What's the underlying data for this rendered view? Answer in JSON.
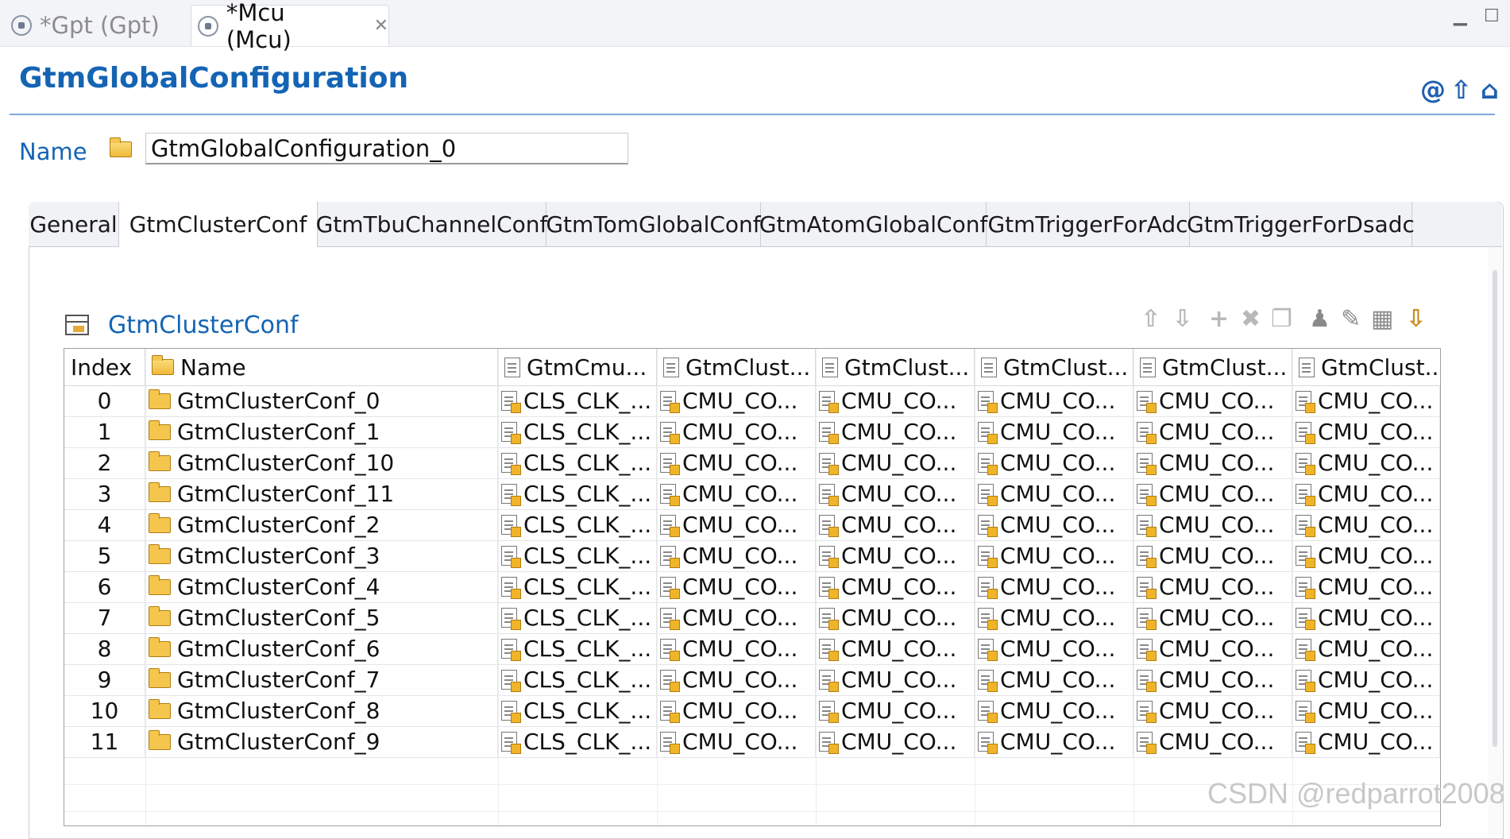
{
  "editor_tabs": [
    {
      "label": "*Gpt (Gpt)"
    },
    {
      "label": "*Mcu (Mcu)"
    }
  ],
  "title": "GtmGlobalConfiguration",
  "name_label": "Name",
  "name_value": "GtmGlobalConfiguration_0",
  "tabs": [
    "General",
    "GtmClusterConf",
    "GtmTbuChannelConf",
    "GtmTomGlobalConf",
    "GtmAtomGlobalConf",
    "GtmTriggerForAdc",
    "GtmTriggerForDsadc"
  ],
  "section_title": "GtmClusterConf",
  "table": {
    "headers": [
      "Index",
      "Name",
      "GtmCmu...",
      "GtmClust...",
      "GtmClust...",
      "GtmClust...",
      "GtmClust...",
      "GtmClust.."
    ],
    "rows": [
      {
        "index": "0",
        "name": "GtmClusterConf_0",
        "v1": "CLS_CLK_...",
        "v2": "CMU_CO...",
        "v3": "CMU_CO...",
        "v4": "CMU_CO...",
        "v5": "CMU_CO...",
        "v6": "CMU_CO..."
      },
      {
        "index": "1",
        "name": "GtmClusterConf_1",
        "v1": "CLS_CLK_...",
        "v2": "CMU_CO...",
        "v3": "CMU_CO...",
        "v4": "CMU_CO...",
        "v5": "CMU_CO...",
        "v6": "CMU_CO..."
      },
      {
        "index": "2",
        "name": "GtmClusterConf_10",
        "v1": "CLS_CLK_...",
        "v2": "CMU_CO...",
        "v3": "CMU_CO...",
        "v4": "CMU_CO...",
        "v5": "CMU_CO...",
        "v6": "CMU_CO..."
      },
      {
        "index": "3",
        "name": "GtmClusterConf_11",
        "v1": "CLS_CLK_...",
        "v2": "CMU_CO...",
        "v3": "CMU_CO...",
        "v4": "CMU_CO...",
        "v5": "CMU_CO...",
        "v6": "CMU_CO..."
      },
      {
        "index": "4",
        "name": "GtmClusterConf_2",
        "v1": "CLS_CLK_...",
        "v2": "CMU_CO...",
        "v3": "CMU_CO...",
        "v4": "CMU_CO...",
        "v5": "CMU_CO...",
        "v6": "CMU_CO..."
      },
      {
        "index": "5",
        "name": "GtmClusterConf_3",
        "v1": "CLS_CLK_...",
        "v2": "CMU_CO...",
        "v3": "CMU_CO...",
        "v4": "CMU_CO...",
        "v5": "CMU_CO...",
        "v6": "CMU_CO..."
      },
      {
        "index": "6",
        "name": "GtmClusterConf_4",
        "v1": "CLS_CLK_...",
        "v2": "CMU_CO...",
        "v3": "CMU_CO...",
        "v4": "CMU_CO...",
        "v5": "CMU_CO...",
        "v6": "CMU_CO..."
      },
      {
        "index": "7",
        "name": "GtmClusterConf_5",
        "v1": "CLS_CLK_...",
        "v2": "CMU_CO...",
        "v3": "CMU_CO...",
        "v4": "CMU_CO...",
        "v5": "CMU_CO...",
        "v6": "CMU_CO..."
      },
      {
        "index": "8",
        "name": "GtmClusterConf_6",
        "v1": "CLS_CLK_...",
        "v2": "CMU_CO...",
        "v3": "CMU_CO...",
        "v4": "CMU_CO...",
        "v5": "CMU_CO...",
        "v6": "CMU_CO..."
      },
      {
        "index": "9",
        "name": "GtmClusterConf_7",
        "v1": "CLS_CLK_...",
        "v2": "CMU_CO...",
        "v3": "CMU_CO...",
        "v4": "CMU_CO...",
        "v5": "CMU_CO...",
        "v6": "CMU_CO..."
      },
      {
        "index": "10",
        "name": "GtmClusterConf_8",
        "v1": "CLS_CLK_...",
        "v2": "CMU_CO...",
        "v3": "CMU_CO...",
        "v4": "CMU_CO...",
        "v5": "CMU_CO...",
        "v6": "CMU_CO..."
      },
      {
        "index": "11",
        "name": "GtmClusterConf_9",
        "v1": "CLS_CLK_...",
        "v2": "CMU_CO...",
        "v3": "CMU_CO...",
        "v4": "CMU_CO...",
        "v5": "CMU_CO...",
        "v6": "CMU_CO..."
      }
    ]
  },
  "icons": {
    "editor_tab": "config-file-icon",
    "name": "open-folder-icon",
    "section": "table-icon",
    "header_actions": [
      "at-sign-icon",
      "arrow-up-icon",
      "home-icon"
    ],
    "toolbar": [
      "move-up-icon",
      "move-down-icon",
      "add-icon",
      "delete-icon",
      "copy-icon",
      "user-edit-icon",
      "pencil-icon",
      "edit-table-icon",
      "import-icon"
    ]
  },
  "watermark": "CSDN @redparrot2008",
  "colors": {
    "accent": "#1464b4",
    "header_line": "#7ea9d8",
    "folder": "#f4c64e"
  }
}
